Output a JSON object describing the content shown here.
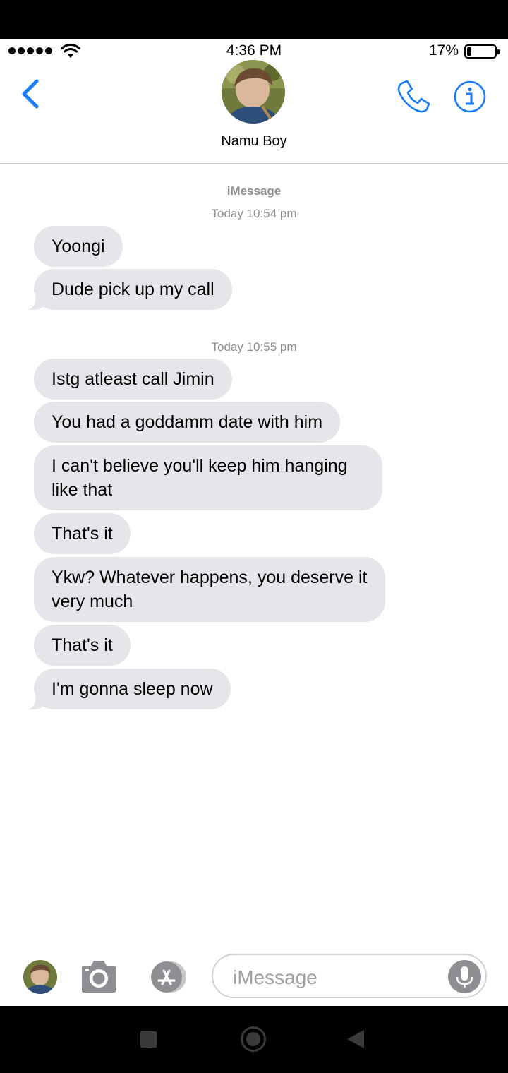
{
  "status_bar": {
    "time": "4:36 PM",
    "battery_percent": "17%",
    "battery_level": 0.17,
    "signal_bars": 5
  },
  "header": {
    "back_icon": "chevron-left-icon",
    "contact_name": "Namu Boy",
    "call_icon": "phone-icon",
    "info_icon": "info-icon"
  },
  "conversation": {
    "service_label": "iMessage",
    "groups": [
      {
        "timestamp": "Today 10:54 pm",
        "messages": [
          "Yoongi",
          "Dude pick up my call"
        ]
      },
      {
        "timestamp": "Today 10:55 pm",
        "messages": [
          "Istg atleast call Jimin",
          "You had a goddamm date with him",
          "I can't believe you'll keep him hanging like that",
          "That's it",
          "Ykw? Whatever happens, you deserve it very much",
          "That's it",
          "I'm gonna sleep now"
        ]
      }
    ]
  },
  "compose": {
    "placeholder": "iMessage",
    "camera_icon": "camera-icon",
    "apps_icon": "app-store-icon",
    "mic_icon": "microphone-icon"
  },
  "colors": {
    "accent": "#1a7cf5",
    "bubble_received": "#e5e5ea",
    "meta_text": "#8e8e93"
  }
}
